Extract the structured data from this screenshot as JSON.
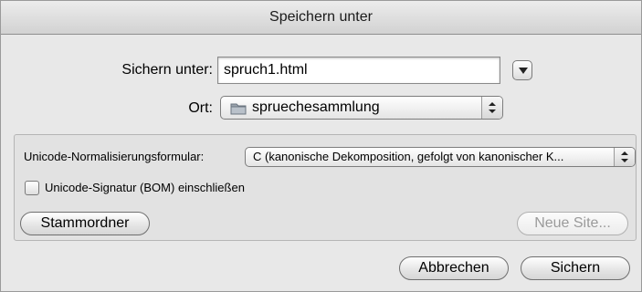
{
  "window": {
    "title": "Speichern unter"
  },
  "save": {
    "label": "Sichern unter:",
    "filename": "spruch1.html"
  },
  "location": {
    "label": "Ort:",
    "selected": "spruechesammlung",
    "icon": "folder-icon"
  },
  "options": {
    "normalization_label": "Unicode-Normalisierungsformular:",
    "normalization_selected": "C (kanonische Dekomposition, gefolgt von kanonischer K...",
    "bom_label": "Unicode-Signatur (BOM) einschließen",
    "bom_checked": false,
    "root_button": "Stammordner",
    "new_site_button": "Neue Site..."
  },
  "buttons": {
    "cancel": "Abbrechen",
    "save": "Sichern"
  }
}
